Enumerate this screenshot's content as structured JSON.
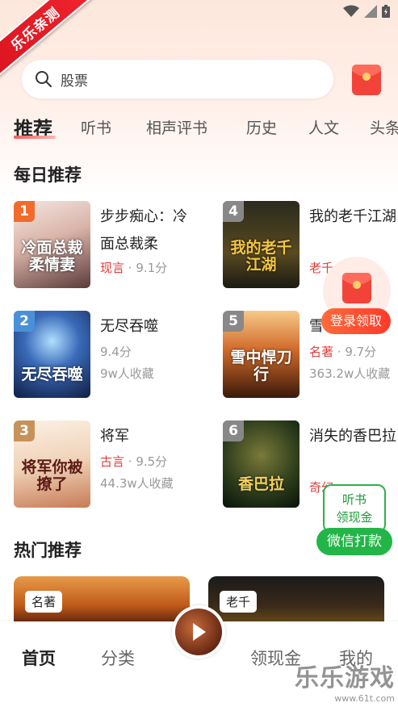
{
  "corner_badge": "乐乐亲测",
  "search": {
    "placeholder": "股票"
  },
  "tabs": [
    "推荐",
    "听书",
    "相声评书",
    "历史",
    "人文",
    "头条"
  ],
  "daily": {
    "title": "每日推荐",
    "books": [
      {
        "rank": "1",
        "title": "步步痴心：冷面总裁柔",
        "category": "现言",
        "score": "9.1分",
        "favorites": "",
        "cover_text": "冷面总裁柔情妻"
      },
      {
        "rank": "2",
        "title": "无尽吞噬",
        "category": "",
        "score": "9.4分",
        "favorites": "9w人收藏",
        "cover_text": "无尽吞噬"
      },
      {
        "rank": "3",
        "title": "将军",
        "category": "古言",
        "score": "9.5分",
        "favorites": "44.3w人收藏",
        "cover_text": "将军你被撩了"
      },
      {
        "rank": "4",
        "title": "我的老千江湖",
        "category": "老千",
        "score": "",
        "favorites": "",
        "cover_text": "我的老千江湖"
      },
      {
        "rank": "5",
        "title": "雪",
        "category": "名著",
        "score": "9.7分",
        "favorites": "363.2w人收藏",
        "cover_text": "雪中悍刀行"
      },
      {
        "rank": "6",
        "title": "消失的香巴拉",
        "category": "奇幻",
        "score": "",
        "favorites": "",
        "cover_text": "香巴拉"
      }
    ]
  },
  "float_redpacket": {
    "label": "登录领取"
  },
  "wechat_float": {
    "line1": "听书",
    "line2": "领现金",
    "pill": "微信打款"
  },
  "hot": {
    "title": "热门推荐",
    "cards": [
      {
        "tag": "名著"
      },
      {
        "tag": "老千"
      }
    ]
  },
  "bottom_nav": [
    "首页",
    "分类",
    "领现金",
    "我的"
  ],
  "watermark": {
    "line1": "乐乐游戏",
    "line2": "www.61t.com"
  },
  "colors": {
    "accent_red": "#e33c3c",
    "wechat_green": "#23b548"
  }
}
